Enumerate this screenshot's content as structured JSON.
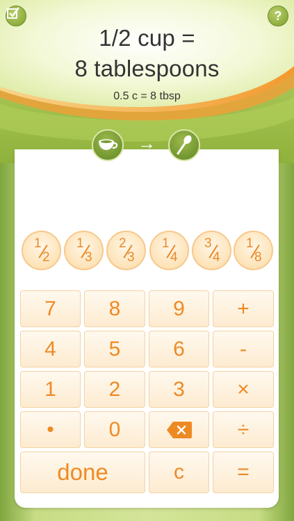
{
  "header": {
    "line1": "1/2 cup =",
    "line2": "8 tablespoons",
    "abbreviation": "0.5 c = 8 tbsp",
    "help_label": "?",
    "arrow": "→",
    "colors": {
      "header_top": "#f6fbe0",
      "header_green": "#a6c64a",
      "accent_orange": "#ee8a24"
    }
  },
  "icons": {
    "check": "checkbox-icon",
    "help": "help-icon",
    "from_unit": "cup-icon",
    "to_unit": "spoon-icon",
    "backspace": "backspace-icon"
  },
  "fractions": [
    {
      "num": "1",
      "den": "2"
    },
    {
      "num": "1",
      "den": "3"
    },
    {
      "num": "2",
      "den": "3"
    },
    {
      "num": "1",
      "den": "4"
    },
    {
      "num": "3",
      "den": "4"
    },
    {
      "num": "1",
      "den": "8"
    }
  ],
  "keys": {
    "k7": "7",
    "k8": "8",
    "k9": "9",
    "plus": "+",
    "k4": "4",
    "k5": "5",
    "k6": "6",
    "minus": "-",
    "k1": "1",
    "k2": "2",
    "k3": "3",
    "times": "×",
    "dot": "•",
    "k0": "0",
    "divide": "÷",
    "done": "done",
    "clear": "c",
    "equals": "="
  }
}
